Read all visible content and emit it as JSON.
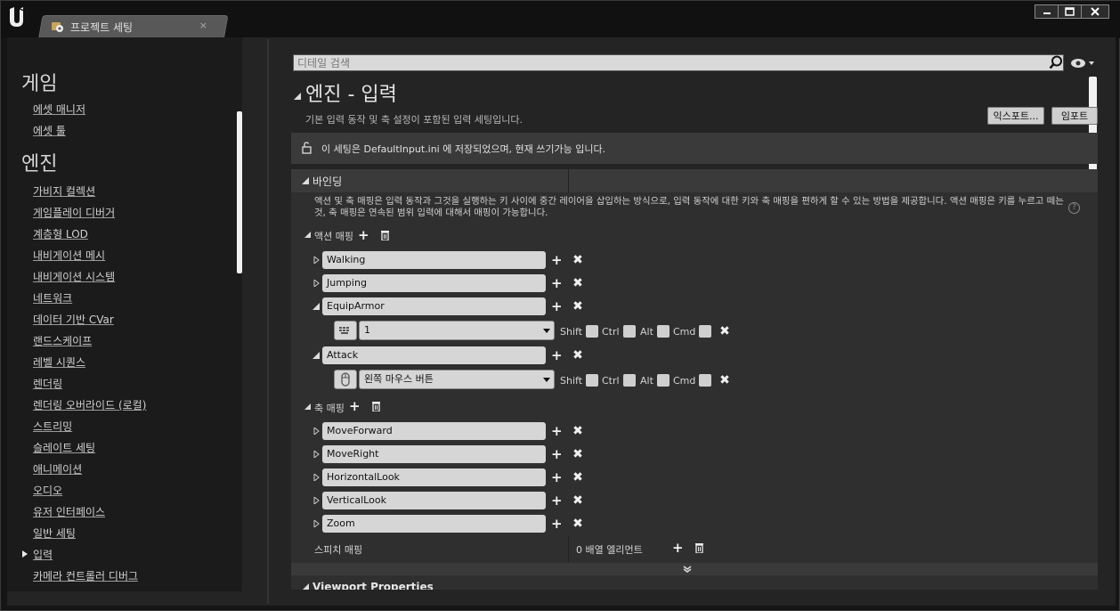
{
  "window": {
    "tab_title": "프로젝트 세팅",
    "tab_close": "×",
    "btn_minimize": "▁",
    "btn_maximize": "▭",
    "btn_close": "✕"
  },
  "sidebar": {
    "headings": [
      "게임",
      "엔진"
    ],
    "game_items": [
      "에셋 매니저",
      "에셋 툴"
    ],
    "engine_items": [
      "가비지 컬렉션",
      "게임플레이 디버거",
      "계층형 LOD",
      "내비게이션 메시",
      "내비게이션 시스템",
      "네트워크",
      "데이터 기반 CVar",
      "랜드스케이프",
      "레벨 시퀀스",
      "렌더링",
      "렌더링 오버라이드 (로컬)",
      "스트리밍",
      "슬레이트 세팅",
      "애니메이션",
      "오디오",
      "유저 인터페이스",
      "일반 세팅",
      "입력",
      "카메라 컨트롤러 디버그"
    ],
    "selected": "입력"
  },
  "search": {
    "placeholder": "디테일 검색"
  },
  "section": {
    "title": "엔진 - 입력",
    "subtitle": "기본 입력 동작 및 축 설정이 포함된 입력 세팅입니다.",
    "export_label": "익스포트...",
    "import_label": "임포트"
  },
  "notice": {
    "text": "이 세팅은 DefaultInput.ini 에 저장되었으며, 현재 쓰기가능 입니다."
  },
  "bindings": {
    "header": "바인딩",
    "description": "액션 및 축 매핑은 입력 동작과 그것을 실행하는 키 사이에 중간 레이어을 삽입하는 방식으로, 입력 동작에 대한 키와 축 매핑을 편하게 할 수 있는 방법을 제공합니다. 액션 매핑은 키를 누르고 떼는 것, 축 매핑은 연속된 범위 입력에 대해서 매핑이 가능합니다.",
    "action_label": "액션 매핑",
    "axis_label": "축 매핑",
    "speech_label": "스피치 매핑",
    "speech_value": "0 배열 엘리먼트",
    "actions": [
      "Walking",
      "Jumping",
      "EquipArmor",
      "Attack"
    ],
    "equip_key": "1",
    "attack_key": "왼쪽 마우스 버튼",
    "modifiers": [
      "Shift",
      "Ctrl",
      "Alt",
      "Cmd"
    ],
    "axes": [
      "MoveForward",
      "MoveRight",
      "HorizontalLook",
      "VerticalLook",
      "Zoom"
    ]
  },
  "viewport": {
    "label": "Viewport Properties"
  },
  "help": "?"
}
